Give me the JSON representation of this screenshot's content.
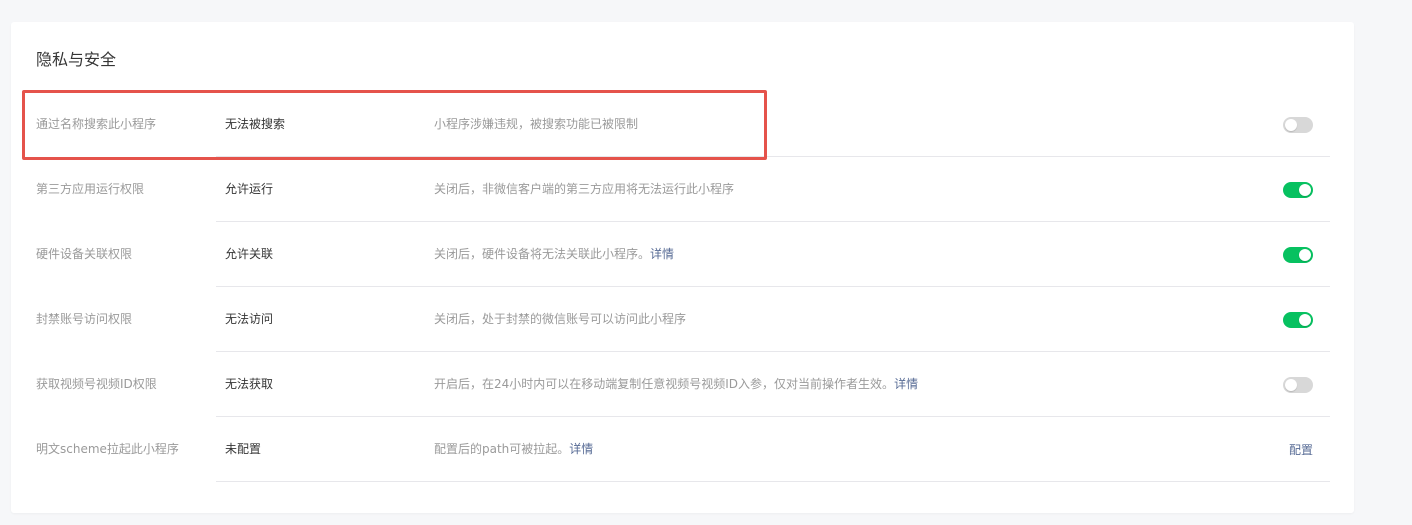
{
  "section": {
    "title": "隐私与安全"
  },
  "rows": [
    {
      "label": "通过名称搜索此小程序",
      "status": "无法被搜索",
      "desc": "小程序涉嫌违规，被搜索功能已被限制",
      "link": "",
      "control": "toggle",
      "enabled": false
    },
    {
      "label": "第三方应用运行权限",
      "status": "允许运行",
      "desc": "关闭后，非微信客户端的第三方应用将无法运行此小程序",
      "link": "",
      "control": "toggle",
      "enabled": true
    },
    {
      "label": "硬件设备关联权限",
      "status": "允许关联",
      "desc": "关闭后，硬件设备将无法关联此小程序。",
      "link": "详情",
      "control": "toggle",
      "enabled": true
    },
    {
      "label": "封禁账号访问权限",
      "status": "无法访问",
      "desc": "关闭后，处于封禁的微信账号可以访问此小程序",
      "link": "",
      "control": "toggle",
      "enabled": true
    },
    {
      "label": "获取视频号视频ID权限",
      "status": "无法获取",
      "desc": "开启后，在24小时内可以在移动端复制任意视频号视频ID入参，仅对当前操作者生效。",
      "link": "详情",
      "control": "toggle",
      "enabled": false
    },
    {
      "label": "明文scheme拉起此小程序",
      "status": "未配置",
      "desc": "配置后的path可被拉起。",
      "link": "详情",
      "control": "link",
      "action_label": "配置"
    }
  ],
  "colors": {
    "toggle_on": "#07c160",
    "toggle_off": "#d8d8d8",
    "link": "#576b95",
    "highlight": "#e5534b"
  }
}
